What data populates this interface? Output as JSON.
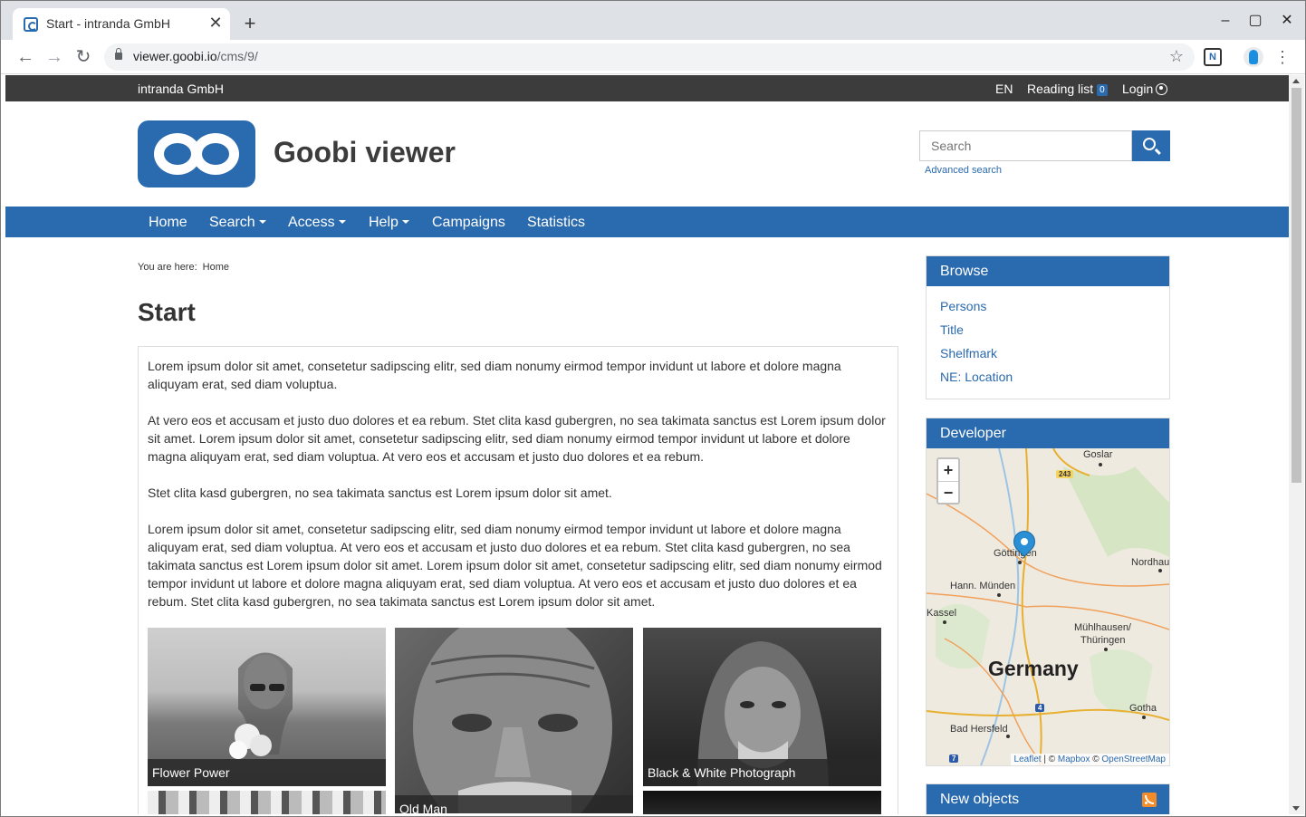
{
  "browser": {
    "tab_title": "Start - intranda GmbH",
    "url_host": "viewer.goobi.io",
    "url_path": "/cms/9/",
    "close_glyph": "✕",
    "new_tab_glyph": "+",
    "minimize_glyph": "–",
    "maximize_glyph": "▢",
    "window_close_glyph": "✕"
  },
  "topbar": {
    "org": "intranda GmbH",
    "language": "EN",
    "reading_list_label": "Reading list",
    "reading_list_count": "0",
    "login_label": "Login"
  },
  "header": {
    "site_title": "Goobi viewer",
    "search_placeholder": "Search",
    "advanced_search": "Advanced search"
  },
  "nav": {
    "items": [
      {
        "label": "Home",
        "dropdown": false
      },
      {
        "label": "Search",
        "dropdown": true
      },
      {
        "label": "Access",
        "dropdown": true
      },
      {
        "label": "Help",
        "dropdown": true
      },
      {
        "label": "Campaigns",
        "dropdown": false
      },
      {
        "label": "Statistics",
        "dropdown": false
      }
    ]
  },
  "breadcrumb": {
    "prefix": "You are here:",
    "items": [
      "Home"
    ]
  },
  "main": {
    "title": "Start",
    "paragraphs": [
      "Lorem ipsum dolor sit amet, consetetur sadipscing elitr, sed diam nonumy eirmod tempor invidunt ut labore et dolore magna aliquyam erat, sed diam voluptua.",
      "At vero eos et accusam et justo duo dolores et ea rebum. Stet clita kasd gubergren, no sea takimata sanctus est Lorem ipsum dolor sit amet. Lorem ipsum dolor sit amet, consetetur sadipscing elitr, sed diam nonumy eirmod tempor invidunt ut labore et dolore magna aliquyam erat, sed diam voluptua. At vero eos et accusam et justo duo dolores et ea rebum.",
      "Stet clita kasd gubergren, no sea takimata sanctus est Lorem ipsum dolor sit amet.",
      "Lorem ipsum dolor sit amet, consetetur sadipscing elitr, sed diam nonumy eirmod tempor invidunt ut labore et dolore magna aliquyam erat, sed diam voluptua. At vero eos et accusam et justo duo dolores et ea rebum. Stet clita kasd gubergren, no sea takimata sanctus est Lorem ipsum dolor sit amet. Lorem ipsum dolor sit amet, consetetur sadipscing elitr, sed diam nonumy eirmod tempor invidunt ut labore et dolore magna aliquyam erat, sed diam voluptua. At vero eos et accusam et justo duo dolores et ea rebum. Stet clita kasd gubergren, no sea takimata sanctus est Lorem ipsum dolor sit amet."
    ],
    "gallery": [
      {
        "caption": "Flower Power"
      },
      {
        "caption": "Old Man"
      },
      {
        "caption": "Black & White Photograph"
      }
    ]
  },
  "sidebar": {
    "browse": {
      "title": "Browse",
      "links": [
        "Persons",
        "Title",
        "Shelfmark",
        "NE: Location"
      ]
    },
    "developer": {
      "title": "Developer",
      "map": {
        "zoom_in": "+",
        "zoom_out": "−",
        "country_label": "Germany",
        "places": [
          "Goslar",
          "Göttingen",
          "Nordhau",
          "Hann. Münden",
          "Kassel",
          "Mühlhausen/",
          "Thüringen",
          "Gotha",
          "Bad Hersfeld"
        ],
        "road_numbers": [
          "243",
          "4",
          "7"
        ],
        "attribution": {
          "leaflet": "Leaflet",
          "sep1": " | © ",
          "mapbox": "Mapbox",
          "sep2": " © ",
          "osm": "OpenStreetMap"
        }
      }
    },
    "new_objects": {
      "title": "New objects",
      "icon": "rss-icon"
    }
  },
  "colors": {
    "brand": "#2a6aae",
    "topbar": "#3c3c3c"
  }
}
